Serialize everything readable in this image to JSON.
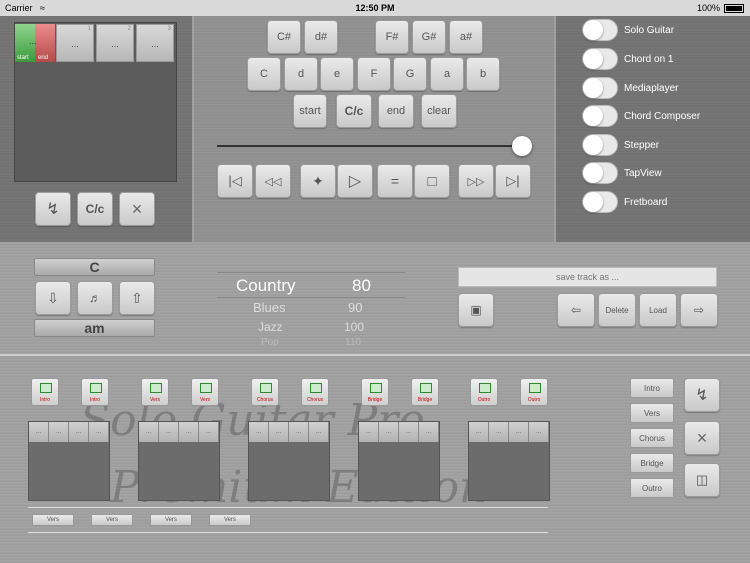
{
  "status_bar": {
    "carrier": "Carrier",
    "time": "12:50 PM",
    "battery": "100%"
  },
  "slots": {
    "first_start": "start",
    "first_end": "end",
    "items": [
      {
        "dots": "...",
        "num": "1"
      },
      {
        "dots": "...",
        "num": "2"
      },
      {
        "dots": "...",
        "num": "3"
      },
      {
        "dots": "...",
        "num": "4"
      }
    ]
  },
  "left_controls": {
    "chord_toggle": "C/c"
  },
  "keyboard": {
    "top_row": [
      "C#",
      "d#",
      "F#",
      "G#",
      "a#"
    ],
    "bottom_row": [
      "C",
      "d",
      "e",
      "F",
      "G",
      "a",
      "b"
    ],
    "actions": [
      "start",
      "C/c",
      "end",
      "clear"
    ]
  },
  "transport": {
    "slider": 1.0
  },
  "toggles": [
    {
      "label": "Solo Guitar",
      "on": false
    },
    {
      "label": "Chord on 1",
      "on": false
    },
    {
      "label": "Mediaplayer",
      "on": false
    },
    {
      "label": "Chord Composer",
      "on": false
    },
    {
      "label": "Stepper",
      "on": false
    },
    {
      "label": "TapView",
      "on": false
    },
    {
      "label": "Fretboard",
      "on": false
    }
  ],
  "chord_picker": {
    "top": "C",
    "bottom": "am"
  },
  "style_picker": [
    {
      "style": "Country",
      "tempo": "80"
    },
    {
      "style": "Blues",
      "tempo": "90"
    },
    {
      "style": "Jazz",
      "tempo": "100"
    },
    {
      "style": "Pop",
      "tempo": "110"
    }
  ],
  "track": {
    "placeholder": "save track as ...",
    "delete_label": "Delete",
    "load_label": "Load"
  },
  "song_tags": [
    "Intro",
    "Intro",
    "Vers",
    "Vers",
    "Chorus",
    "Chorus",
    "Bridge",
    "Bridge",
    "Outro",
    "Outro"
  ],
  "song_blocks": [
    [
      "...",
      "...",
      "...",
      "..."
    ],
    [
      "...",
      "...",
      "...",
      "..."
    ],
    [
      "...",
      "...",
      "...",
      "..."
    ],
    [
      "...",
      "...",
      "...",
      "..."
    ],
    [
      "...",
      "...",
      "...",
      "..."
    ]
  ],
  "parts": [
    "Intro",
    "Vers",
    "Chorus",
    "Bridge",
    "Outro"
  ],
  "vers_buttons": [
    "Vers",
    "Vers",
    "Vers",
    "Vers"
  ],
  "watermark": {
    "line1": "Solo Guitar Pro",
    "line2": "Premium Edition"
  }
}
